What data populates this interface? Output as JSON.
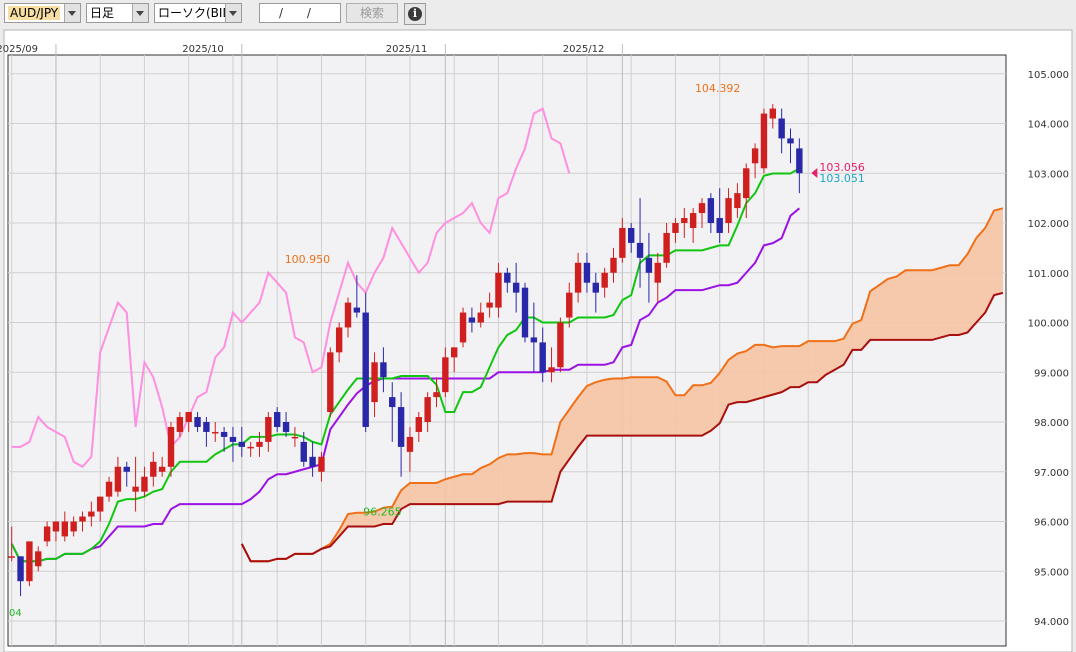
{
  "toolbar": {
    "pair": "AUD/JPY",
    "period": "日足",
    "chart_kind": "ローソク(BID)",
    "date_value": "/ /",
    "search_label": "検索",
    "info_glyph": "i",
    "info_icon": "info-icon",
    "pair_bg": "#f7dfa3"
  },
  "chart_data": {
    "type": "candlestick",
    "pair": "AUD/JPY",
    "price_label": "ローソク(BID)",
    "x_labels": [
      "2025/09",
      "2025/10",
      "2025/11",
      "2025/12"
    ],
    "x_label_index": [
      5,
      26,
      49,
      69
    ],
    "y_ticks": [
      "94.000",
      "95.000",
      "96.000",
      "97.000",
      "98.000",
      "99.000",
      "100.000",
      "101.000",
      "102.000",
      "103.000",
      "104.000",
      "105.000"
    ],
    "ylim": [
      93.75,
      105.25
    ],
    "grid": true,
    "colors": {
      "up": "#d01f1f",
      "down": "#2828a8",
      "conversion": "#11c611",
      "base": "#9b11e6",
      "lagging": "#ff8fe0",
      "span_a": "#f07018",
      "span_b": "#a80f0f",
      "cloud": "#f6c4a4"
    },
    "annotations": [
      {
        "text": "104.392",
        "color": "#f07018",
        "i": 80,
        "price": 104.392
      },
      {
        "text": "100.950",
        "color": "#f07018",
        "i": 35,
        "price": 100.95
      },
      {
        "text": "96.265",
        "color": "#22bb22",
        "i": 42,
        "price": 96.265
      },
      {
        "text": "103.056",
        "color": "#e5206a"
      },
      {
        "text": "103.051",
        "color": "#17a7c5"
      },
      {
        "text": "04",
        "color": "#22bb22"
      }
    ],
    "candles": [
      [
        95.3,
        95.9,
        95.2,
        95.3
      ],
      [
        95.3,
        95.3,
        94.5,
        94.8
      ],
      [
        94.8,
        95.6,
        94.7,
        95.6
      ],
      [
        95.1,
        95.5,
        95.0,
        95.4
      ],
      [
        95.6,
        96.0,
        95.5,
        95.9
      ],
      [
        95.8,
        96.0,
        95.6,
        96.0
      ],
      [
        95.7,
        96.2,
        95.6,
        96.0
      ],
      [
        95.8,
        96.1,
        95.7,
        96.0
      ],
      [
        96.0,
        96.2,
        95.8,
        96.1
      ],
      [
        96.1,
        96.4,
        95.9,
        96.2
      ],
      [
        96.2,
        96.5,
        96.0,
        96.5
      ],
      [
        96.5,
        96.9,
        96.4,
        96.8
      ],
      [
        96.6,
        97.3,
        96.5,
        97.1
      ],
      [
        97.1,
        97.2,
        96.7,
        97.0
      ],
      [
        96.6,
        97.3,
        96.2,
        96.7
      ],
      [
        96.6,
        97.1,
        96.5,
        96.9
      ],
      [
        96.9,
        97.4,
        96.7,
        97.2
      ],
      [
        97.0,
        97.3,
        96.9,
        97.1
      ],
      [
        97.1,
        98.0,
        96.9,
        97.9
      ],
      [
        97.8,
        98.2,
        97.7,
        98.1
      ],
      [
        98.0,
        98.2,
        97.8,
        98.2
      ],
      [
        98.1,
        98.2,
        97.8,
        97.9
      ],
      [
        98.0,
        98.1,
        97.5,
        97.8
      ],
      [
        97.8,
        98.0,
        97.6,
        97.8
      ],
      [
        97.8,
        97.9,
        97.4,
        97.7
      ],
      [
        97.7,
        97.9,
        97.2,
        97.6
      ],
      [
        97.6,
        97.9,
        97.3,
        97.5
      ],
      [
        97.5,
        97.6,
        97.3,
        97.5
      ],
      [
        97.5,
        97.8,
        97.3,
        97.6
      ],
      [
        97.6,
        98.2,
        97.4,
        98.1
      ],
      [
        98.2,
        98.3,
        97.8,
        97.9
      ],
      [
        98.0,
        98.2,
        97.7,
        97.8
      ],
      [
        97.7,
        97.9,
        97.5,
        97.7
      ],
      [
        97.6,
        97.8,
        97.1,
        97.2
      ],
      [
        97.3,
        97.6,
        96.9,
        97.1
      ],
      [
        97.0,
        97.4,
        96.8,
        97.3
      ],
      [
        98.2,
        99.5,
        98.1,
        99.4
      ],
      [
        99.4,
        100.0,
        99.2,
        99.9
      ],
      [
        99.9,
        100.5,
        99.7,
        100.4
      ],
      [
        100.3,
        100.95,
        100.1,
        100.2
      ],
      [
        100.2,
        100.6,
        97.8,
        97.9
      ],
      [
        98.4,
        99.4,
        98.1,
        99.2
      ],
      [
        99.2,
        99.5,
        98.6,
        98.9
      ],
      [
        98.5,
        98.8,
        97.6,
        98.3
      ],
      [
        98.3,
        98.6,
        96.9,
        97.5
      ],
      [
        97.4,
        97.9,
        97.0,
        97.7
      ],
      [
        97.8,
        98.2,
        97.6,
        98.1
      ],
      [
        98.0,
        98.6,
        97.8,
        98.5
      ],
      [
        98.5,
        98.9,
        98.3,
        98.6
      ],
      [
        98.6,
        99.5,
        98.5,
        99.3
      ],
      [
        99.3,
        99.5,
        99.0,
        99.5
      ],
      [
        99.6,
        100.3,
        99.5,
        100.2
      ],
      [
        100.1,
        100.3,
        99.8,
        100.0
      ],
      [
        100.0,
        100.4,
        99.9,
        100.2
      ],
      [
        100.3,
        100.6,
        100.1,
        100.4
      ],
      [
        100.3,
        101.2,
        100.1,
        101.0
      ],
      [
        101.0,
        101.1,
        100.6,
        100.8
      ],
      [
        100.8,
        101.2,
        100.2,
        100.6
      ],
      [
        100.7,
        100.8,
        99.6,
        99.7
      ],
      [
        99.7,
        100.4,
        99.0,
        99.6
      ],
      [
        99.6,
        99.9,
        98.8,
        99.0
      ],
      [
        99.0,
        99.5,
        98.8,
        99.1
      ],
      [
        99.1,
        100.1,
        99.0,
        100.0
      ],
      [
        100.1,
        100.8,
        99.9,
        100.6
      ],
      [
        100.6,
        101.4,
        100.4,
        101.2
      ],
      [
        101.2,
        101.4,
        100.6,
        100.8
      ],
      [
        100.8,
        101.0,
        100.2,
        100.6
      ],
      [
        100.7,
        101.1,
        100.5,
        101.0
      ],
      [
        101.0,
        101.5,
        100.8,
        101.3
      ],
      [
        101.3,
        102.1,
        101.2,
        101.9
      ],
      [
        101.9,
        102.0,
        101.4,
        101.6
      ],
      [
        101.6,
        102.5,
        100.7,
        101.3
      ],
      [
        101.3,
        101.8,
        100.4,
        101.0
      ],
      [
        100.8,
        101.4,
        100.4,
        101.2
      ],
      [
        101.2,
        102.0,
        101.1,
        101.8
      ],
      [
        101.8,
        102.1,
        101.6,
        102.0
      ],
      [
        102.0,
        102.3,
        101.7,
        102.1
      ],
      [
        101.9,
        102.3,
        101.6,
        102.2
      ],
      [
        102.2,
        102.5,
        101.9,
        102.4
      ],
      [
        102.5,
        102.6,
        101.8,
        102.0
      ],
      [
        102.1,
        102.7,
        101.6,
        101.8
      ],
      [
        102.0,
        102.7,
        101.8,
        102.5
      ],
      [
        102.3,
        102.8,
        102.1,
        102.6
      ],
      [
        102.5,
        103.2,
        102.1,
        103.1
      ],
      [
        103.2,
        103.6,
        102.9,
        103.5
      ],
      [
        103.1,
        104.3,
        103.0,
        104.2
      ],
      [
        104.1,
        104.39,
        103.9,
        104.3
      ],
      [
        104.1,
        104.3,
        103.4,
        103.7
      ],
      [
        103.7,
        103.9,
        103.2,
        103.6
      ],
      [
        103.5,
        103.7,
        102.6,
        103.0
      ]
    ]
  }
}
